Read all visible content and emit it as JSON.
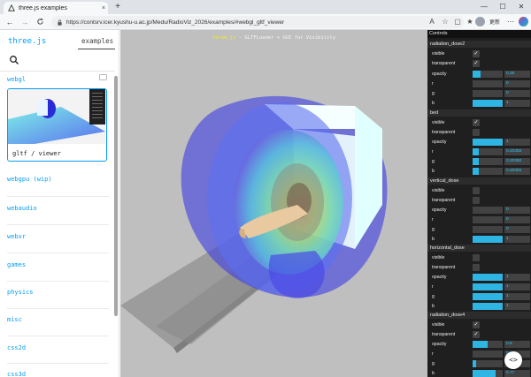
{
  "browser": {
    "tab_title": "three.js examples",
    "tab_close": "×",
    "new_tab": "+",
    "minimize": "—",
    "maximize": "☐",
    "close": "✕",
    "back": "←",
    "forward": "→",
    "reload": "C",
    "url": "https://contsrv.icer.kyushu-u.ac.jp/Medu/RadioViz_2026/examples/#webgl_gltf_viewer",
    "profile_status": "更新",
    "toolbar_icons": [
      "read-aloud-icon",
      "star-icon",
      "split-screen-icon",
      "favorites-icon",
      "collections-icon",
      "extensions-icon",
      "more-icon"
    ]
  },
  "sidebar": {
    "logo": "three.js",
    "examples_tab": "examples",
    "active_category": "webgl",
    "selected_example": "gltf / viewer",
    "categories": [
      "webgpu (wip)",
      "webaudio",
      "webxr",
      "games",
      "physics",
      "misc",
      "css2d",
      "css3d"
    ]
  },
  "viewport": {
    "info_brand": "three.js",
    "info_text": " - GLTFLoader + GUI for Visibility"
  },
  "gui": {
    "title": "Controls",
    "folders": [
      {
        "name": "radiation_dose2",
        "visible": true,
        "transparent": true,
        "opacity": "0.25",
        "opacity_fill": 0.25,
        "r": "0",
        "g": "0",
        "b": "1",
        "r_fill": 0,
        "g_fill": 0,
        "b_fill": 1
      },
      {
        "name": "bed",
        "visible": true,
        "transparent": false,
        "opacity": "1",
        "opacity_fill": 1,
        "r": "0.20392",
        "g": "0.20392",
        "b": "0.20392",
        "r_fill": 0.2,
        "g_fill": 0.2,
        "b_fill": 0.2
      },
      {
        "name": "vertical_dose",
        "visible": false,
        "transparent": false,
        "opacity": "0",
        "opacity_fill": 0,
        "r": "0",
        "g": "0",
        "b": "1",
        "r_fill": 0,
        "g_fill": 0,
        "b_fill": 1
      },
      {
        "name": "horizontal_dose",
        "visible": false,
        "transparent": false,
        "opacity": "1",
        "opacity_fill": 1,
        "r": "1",
        "g": "1",
        "b": "1",
        "r_fill": 1,
        "g_fill": 1,
        "b_fill": 1
      },
      {
        "name": "radiation_dose4",
        "visible": true,
        "transparent": true,
        "opacity": "0.5",
        "opacity_fill": 0.5,
        "r": "0",
        "g": "0.12",
        "b": "0.77",
        "r_fill": 0,
        "g_fill": 0.12,
        "b_fill": 0.77
      }
    ],
    "checkmark": "✓",
    "labels": {
      "visible": "visible",
      "transparent": "transparent",
      "opacity": "opacity",
      "r": "r",
      "g": "g",
      "b": "b"
    }
  },
  "fab": "<>",
  "colors": {
    "accent": "#049ef4",
    "gui_bg": "#1f1f1f",
    "gui_number": "#2cc9ff",
    "viewport_bg": "#bfbfbf"
  }
}
